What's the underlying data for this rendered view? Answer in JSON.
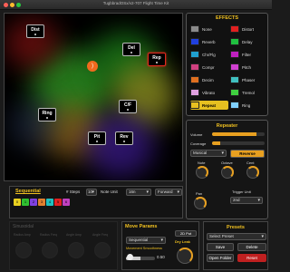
{
  "window": {
    "title": "TugbbradOSx/v2-707 Flight Time Kit"
  },
  "canvas": {
    "nodes": [
      {
        "label": "Dist",
        "active": false
      },
      {
        "label": "Del",
        "active": false
      },
      {
        "label": "Rep",
        "active": true
      },
      {
        "label": "C/F",
        "active": false
      },
      {
        "label": "Ring",
        "active": false
      },
      {
        "label": "Pit",
        "active": false
      },
      {
        "label": "Rev",
        "active": false
      }
    ],
    "listener_icon": "ear-icon"
  },
  "effects": {
    "title": "EFFECTS",
    "items": [
      {
        "label": "None",
        "color": "#8a8a8a"
      },
      {
        "label": "Distort",
        "color": "#e02020"
      },
      {
        "label": "Reverb",
        "color": "#2040e0"
      },
      {
        "label": "Delay",
        "color": "#20c040"
      },
      {
        "label": "Chr/Flg",
        "color": "#20a0d0"
      },
      {
        "label": "Filter",
        "color": "#c020c0"
      },
      {
        "label": "Compr",
        "color": "#d04080"
      },
      {
        "label": "Pitch",
        "color": "#d040d0"
      },
      {
        "label": "Decim",
        "color": "#e07020"
      },
      {
        "label": "Phaser",
        "color": "#40c0c0"
      },
      {
        "label": "Vibrato",
        "color": "#e0a0e0"
      },
      {
        "label": "Tremol",
        "color": "#40d040"
      },
      {
        "label": "Repeat",
        "color": "#e8c020",
        "selected": true
      },
      {
        "label": "Ring",
        "color": "#80d0ff"
      }
    ]
  },
  "repeater": {
    "title": "Repeater",
    "volume_label": "Volume",
    "volume_value": 0.85,
    "coverage_label": "Coverage",
    "coverage_value": 0.15,
    "mode_value": "Musical",
    "reverse_label": "Reverse",
    "note_label": "Note",
    "octave_label": "Octave",
    "cent_label": "Cent",
    "pan_label": "Pan",
    "trigger_unit_label": "Trigger Unit",
    "trigger_unit_value": "2nd"
  },
  "sequential": {
    "title": "Sequential",
    "steps_label": "# Steps",
    "steps_value": "10",
    "note_unit_label": "Note Unit",
    "note_unit_value": "16n",
    "direction_value": "Forward",
    "steps": [
      {
        "n": "0",
        "color": "#e8d020"
      },
      {
        "n": "1",
        "color": "#30c030"
      },
      {
        "n": "2",
        "color": "#8040e0"
      },
      {
        "n": "3",
        "color": "#e08030"
      },
      {
        "n": "4",
        "color": "#20c0c0"
      },
      {
        "n": "5",
        "color": "#e02020"
      },
      {
        "n": "6",
        "color": "#c040c0"
      }
    ]
  },
  "sinusoidal": {
    "title": "Sinusoidal",
    "knob_labels": [
      "Radius Amp",
      "Radius Freq",
      "Angle Amp",
      "Angle Freq"
    ]
  },
  "move_params": {
    "title": "Move Params",
    "mode_value": "Sequential",
    "button_2d": "2D Pot",
    "dry_leak_label": "Dry Leak",
    "smoothness_label": "Movement Smoothness",
    "smoothness_value": "0.50"
  },
  "presets": {
    "title": "Presets",
    "select_placeholder": "Select Preset",
    "save_label": "Save",
    "delete_label": "Delete",
    "open_folder_label": "Open Folder",
    "reset_label": "Reset"
  }
}
